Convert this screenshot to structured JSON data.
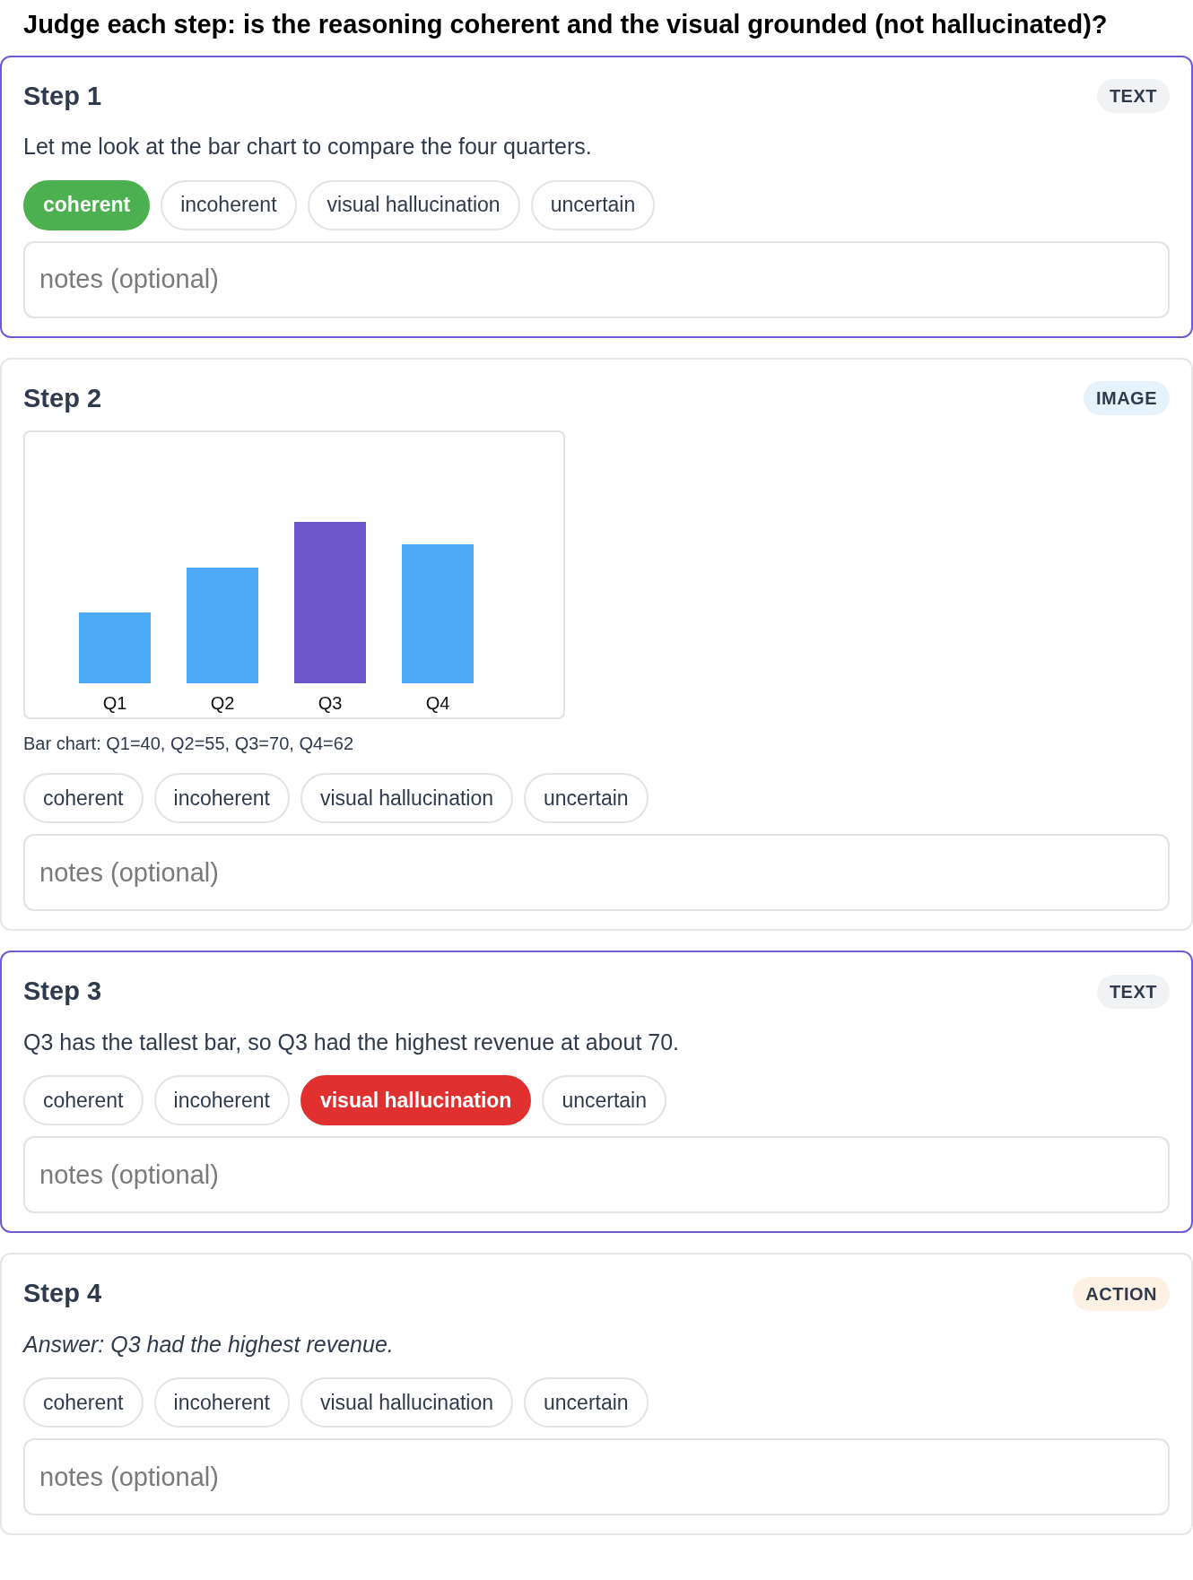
{
  "heading": "Judge each step: is the reasoning coherent and the visual grounded (not hallucinated)?",
  "steps": [
    {
      "title": "Step 1",
      "kind": "text",
      "badge": "TEXT",
      "text": "Let me look at the bar chart to compare the four quarters.",
      "labels": [
        {
          "label": "coherent",
          "kind": "coherent",
          "selected": true
        },
        {
          "label": "incoherent",
          "kind": "incoherent",
          "selected": false
        },
        {
          "label": "visual hallucination",
          "kind": "hallucination",
          "selected": false
        },
        {
          "label": "uncertain",
          "kind": "uncertain",
          "selected": false
        }
      ],
      "notes": {
        "placeholder": "notes (optional)"
      }
    },
    {
      "title": "Step 2",
      "kind": "image",
      "badge": "IMAGE",
      "caption": "Bar chart: Q1=40, Q2=55, Q3=70, Q4=62",
      "chart_labels": [
        "Q1",
        "Q2",
        "Q3",
        "Q4"
      ],
      "labels": [
        {
          "label": "coherent",
          "kind": "coherent",
          "selected": false
        },
        {
          "label": "incoherent",
          "kind": "incoherent",
          "selected": false
        },
        {
          "label": "visual hallucination",
          "kind": "hallucination",
          "selected": false
        },
        {
          "label": "uncertain",
          "kind": "uncertain",
          "selected": false
        }
      ],
      "notes": {
        "placeholder": "notes (optional)"
      }
    },
    {
      "title": "Step 3",
      "kind": "text",
      "badge": "TEXT",
      "text": "Q3 has the tallest bar, so Q3 had the highest revenue at about 70.",
      "labels": [
        {
          "label": "coherent",
          "kind": "coherent",
          "selected": false
        },
        {
          "label": "incoherent",
          "kind": "incoherent",
          "selected": false
        },
        {
          "label": "visual hallucination",
          "kind": "hallucination",
          "selected": true
        },
        {
          "label": "uncertain",
          "kind": "uncertain",
          "selected": false
        }
      ],
      "notes": {
        "placeholder": "notes (optional)"
      }
    },
    {
      "title": "Step 4",
      "kind": "action",
      "badge": "ACTION",
      "text": "Answer: Q3 had the highest revenue.",
      "labels": [
        {
          "label": "coherent",
          "kind": "coherent",
          "selected": false
        },
        {
          "label": "incoherent",
          "kind": "incoherent",
          "selected": false
        },
        {
          "label": "visual hallucination",
          "kind": "hallucination",
          "selected": false
        },
        {
          "label": "uncertain",
          "kind": "uncertain",
          "selected": false
        }
      ],
      "notes": {
        "placeholder": "notes (optional)"
      }
    }
  ]
}
